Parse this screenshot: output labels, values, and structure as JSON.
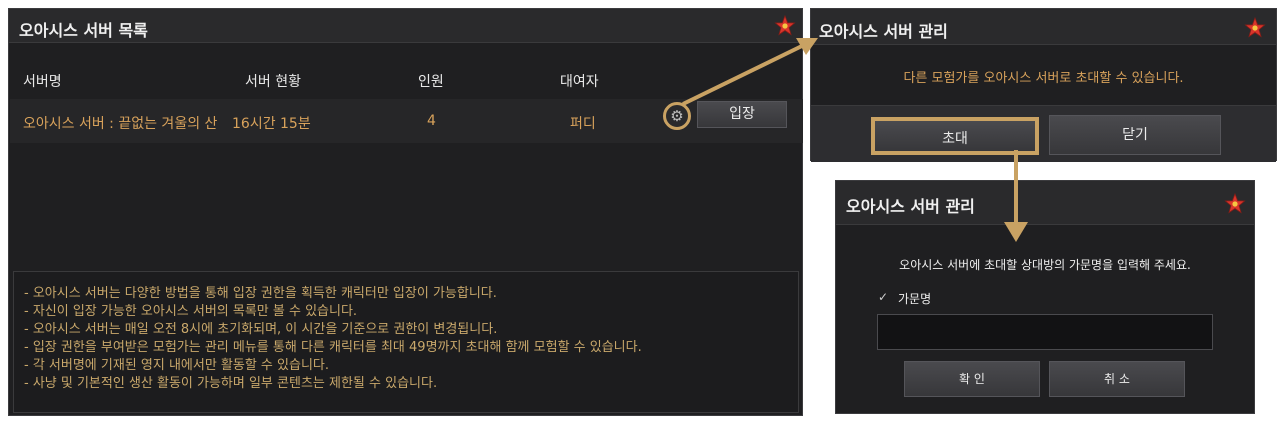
{
  "server_list_panel": {
    "title": "오아시스 서버 목록",
    "columns": [
      "서버명",
      "서버 현황",
      "인원",
      "대여자"
    ],
    "row": {
      "name": "오아시스 서버 : 끝없는 겨울의 산",
      "status": "16시간 15분",
      "members": "4",
      "lender": "퍼디",
      "settings_icon": "gear-icon",
      "enter_label": "입장"
    },
    "notes": [
      "- 오아시스 서버는 다양한 방법을 통해 입장 권한을 획득한 캐릭터만 입장이 가능합니다.",
      "- 자신이 입장 가능한 오아시스 서버의 목록만 볼 수 있습니다.",
      "- 오아시스 서버는 매일 오전 8시에 초기화되며, 이 시간을 기준으로 권한이 변경됩니다.",
      "- 입장 권한을 부여받은 모험가는 관리 메뉴를 통해 다른 캐릭터를 최대 49명까지 초대해 함께 모험할 수 있습니다.",
      "- 각 서버명에 기재된 영지 내에서만 활동할 수 있습니다.",
      "- 사냥 및 기본적인 생산 활동이 가능하며 일부 콘텐츠는 제한될 수 있습니다."
    ]
  },
  "manage_panel": {
    "title": "오아시스 서버 관리",
    "message": "다른 모험가를 오아시스 서버로 초대할 수 있습니다.",
    "invite_label": "초대",
    "close_label": "닫기"
  },
  "invite_panel": {
    "title": "오아시스 서버 관리",
    "message": "오아시스 서버에 초대할 상대방의 가문명을 입력해 주세요.",
    "field_label": "가문명",
    "field_value": "",
    "confirm_label": "확 인",
    "cancel_label": "취 소"
  },
  "colors": {
    "accent_gold": "#c9a263",
    "text_gold": "#d8a25b",
    "panel_bg": "#1f1f21",
    "star_red": "#d9342b",
    "star_yellow": "#f5c642"
  }
}
